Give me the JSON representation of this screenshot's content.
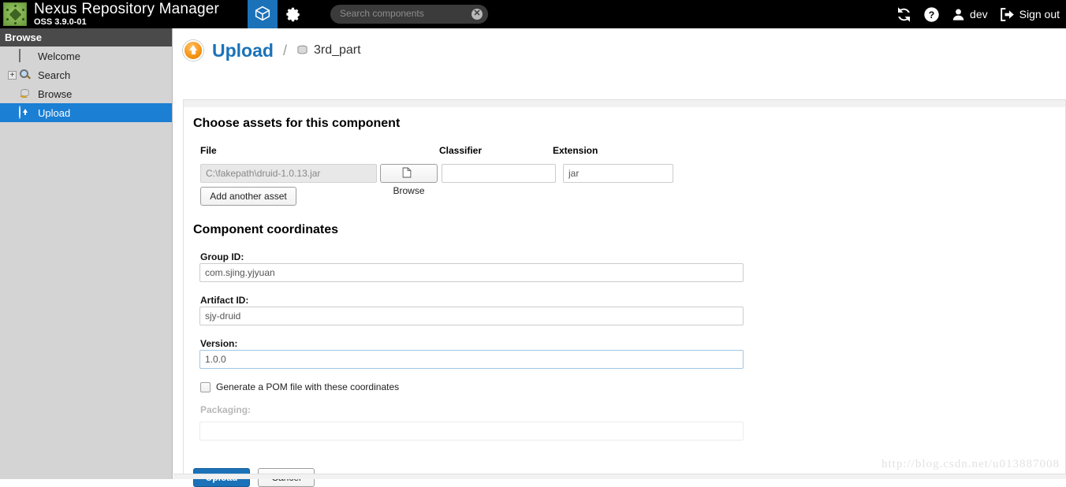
{
  "header": {
    "brand_title": "Nexus Repository Manager",
    "brand_subtitle": "OSS 3.9.0-01",
    "logo_icon": "nexus-cube-logo",
    "mode_icon": "cube-icon",
    "gear_icon": "gear-icon",
    "search": {
      "placeholder": "Search components",
      "value": "",
      "clear_label": "✕",
      "icon": "clear-icon"
    },
    "refresh_icon": "refresh-icon",
    "help_icon": "help-icon",
    "user_icon": "user-icon",
    "user_label": "dev",
    "signout_icon": "sign-out-icon",
    "signout_label": "Sign out"
  },
  "sidebar": {
    "header": "Browse",
    "items": [
      {
        "label": "Welcome",
        "icon": "welcome-icon",
        "selected": false,
        "expandable": false
      },
      {
        "label": "Search",
        "icon": "search-icon",
        "selected": false,
        "expandable": true,
        "expander": "+"
      },
      {
        "label": "Browse",
        "icon": "database-icon",
        "selected": false,
        "expandable": false
      },
      {
        "label": "Upload",
        "icon": "upload-icon",
        "selected": true,
        "expandable": false
      }
    ]
  },
  "page": {
    "title": "Upload",
    "title_icon": "upload-icon",
    "breadcrumb_separator": "/",
    "breadcrumb_repo_icon": "database-icon",
    "breadcrumb_repo": "3rd_part"
  },
  "assets_section": {
    "title": "Choose assets for this component",
    "columns": {
      "file": "File",
      "classifier": "Classifier",
      "extension": "Extension"
    },
    "rows": [
      {
        "file_value": "C:\\fakepath\\druid-1.0.13.jar",
        "browse_label": "Browse",
        "browse_icon": "file-icon",
        "classifier_value": "",
        "classifier_placeholder": "",
        "extension_value": "jar"
      }
    ],
    "add_asset_label": "Add another asset"
  },
  "coordinates_section": {
    "title": "Component coordinates",
    "fields": [
      {
        "label": "Group ID:",
        "value": "com.sjing.yjyuan",
        "disabled": false,
        "focused": false
      },
      {
        "label": "Artifact ID:",
        "value": "sjy-druid",
        "disabled": false,
        "focused": false
      },
      {
        "label": "Version:",
        "value": "1.0.0",
        "disabled": false,
        "focused": true
      }
    ],
    "generate_pom": {
      "label": "Generate a POM file with these coordinates",
      "checked": false
    },
    "packaging": {
      "label": "Packaging:",
      "value": "",
      "disabled": true
    }
  },
  "actions": {
    "upload_label": "Upload",
    "cancel_label": "Cancel"
  },
  "watermark": "http://blog.csdn.net/u013887008",
  "colors": {
    "accent_blue": "#1b72b8",
    "topbar_black": "#000000",
    "sidebar_gray": "#d4d4d4",
    "sidebar_header": "#4a4a4a",
    "selected_blue": "#1b7fd4",
    "upload_orange": "#f28f0c"
  }
}
